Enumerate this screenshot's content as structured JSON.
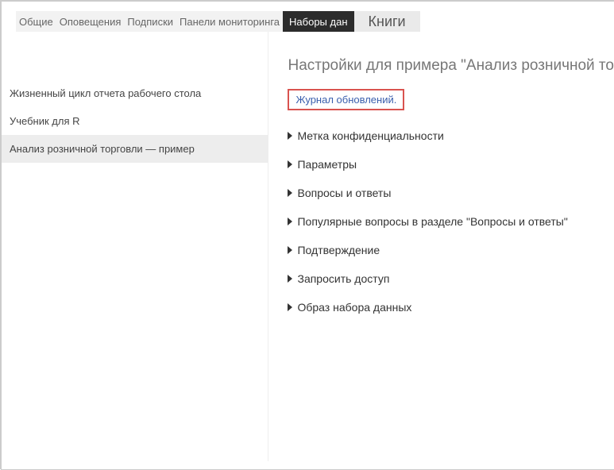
{
  "tabs": {
    "general": "Общие",
    "alerts": "Оповещения",
    "subscriptions": "Подписки",
    "dashboards": "Панели мониторинга",
    "datasets": "Наборы дан",
    "books": "Книги"
  },
  "sidebar": {
    "items": [
      "Жизненный цикл отчета рабочего стола",
      "Учебник для R",
      "Анализ розничной торговли — пример"
    ]
  },
  "main": {
    "title": "Настройки для примера \"Анализ розничной то",
    "refresh_link": "Журнал обновлений.",
    "sections": [
      "Метка конфиденциальности",
      "Параметры",
      "Вопросы и ответы",
      "Популярные вопросы в разделе \"Вопросы и ответы\"",
      "Подтверждение",
      "Запросить доступ",
      "Образ набора данных"
    ]
  }
}
